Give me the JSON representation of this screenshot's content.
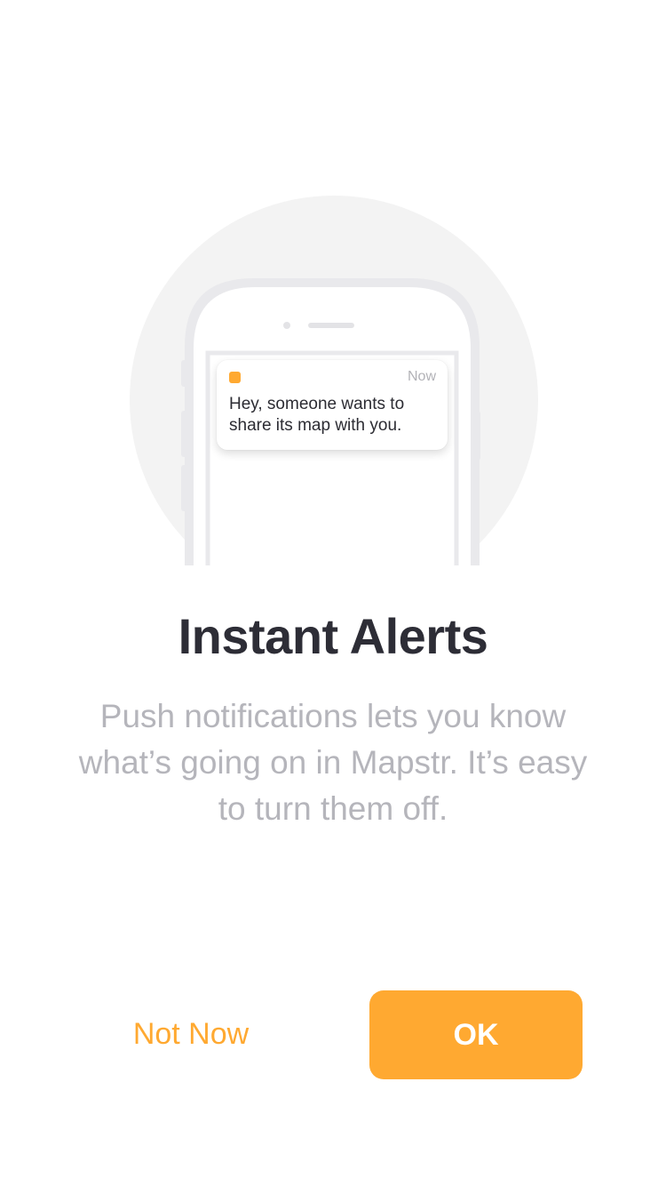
{
  "illustration": {
    "notification": {
      "time": "Now",
      "message": "Hey, someone wants to share its map with you."
    }
  },
  "onboarding": {
    "title": "Instant Alerts",
    "description": "Push notifications lets you know what’s going on in Mapstr. It’s easy to turn them off."
  },
  "actions": {
    "not_now_label": "Not Now",
    "ok_label": "OK"
  },
  "colors": {
    "accent": "#FFA931",
    "title": "#2D2D36",
    "body_text": "#B5B5BB",
    "circle_background": "#F3F3F3",
    "phone_outline": "#E9E9EC"
  }
}
